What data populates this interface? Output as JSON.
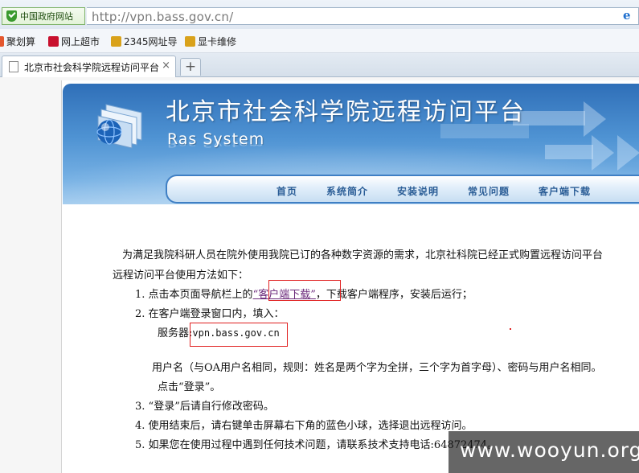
{
  "browser": {
    "gov_badge": "中国政府网站",
    "url": "http://vpn.bass.gov.cn/",
    "favorites": [
      {
        "label": "聚划算",
        "icon": "juhuasuan-icon",
        "color": "#e4572e"
      },
      {
        "label": "网上超市",
        "icon": "tmall-icon",
        "color": "#c8102e"
      },
      {
        "label": "2345网址导",
        "icon": "site-2345-icon",
        "color": "#d9a21b"
      },
      {
        "label": "显卡维修",
        "icon": "site-2345-icon",
        "color": "#d9a21b"
      }
    ],
    "tab": {
      "title": "北京市社会科学院远程访问平台",
      "close": "×"
    },
    "new_tab": "+"
  },
  "header": {
    "title": "北京市社会科学院远程访问平台",
    "subtitle": "Ras System",
    "nav": [
      "首页",
      "系统简介",
      "安装说明",
      "常见问题",
      "客户端下载"
    ]
  },
  "content": {
    "intro_line1": "为满足我院科研人员在院外使用我院已订的各种数字资源的需求，北京社科院已经正式购置远程访问平台",
    "intro_line2": "远程访问平台使用方法如下：",
    "step1_num": "1.",
    "step1_pre": "点击本页面导航栏上的",
    "step1_link": "“客户端下载”",
    "step1_post": "，下载客户端程序，安装后运行；",
    "step2_num": "2.",
    "step2": "在客户端登录窗口内，填入：",
    "server_label": "服务器:",
    "server_value": "vpn.bass.gov.cn",
    "username_line": "用户名（与OA用户名相同，规则：姓名是两个字为全拼，三个字为首字母）、密码与用户名相同。",
    "login_line": "点击“登录”。",
    "step3_num": "3.",
    "step3": "“登录”后请自行修改密码。",
    "step4_num": "4.",
    "step4": "使用结束后，请右键单击屏幕右下角的蓝色小球，选择退出远程访问。",
    "step5_num": "5.",
    "step5": "如果您在使用过程中遇到任何技术问题，请联系技术支持电话:64872474。"
  },
  "watermark": "www.wooyun.org",
  "colors": {
    "highlight": "#e02020",
    "nav_text": "#2a5d96",
    "banner": "#4f93d3"
  }
}
